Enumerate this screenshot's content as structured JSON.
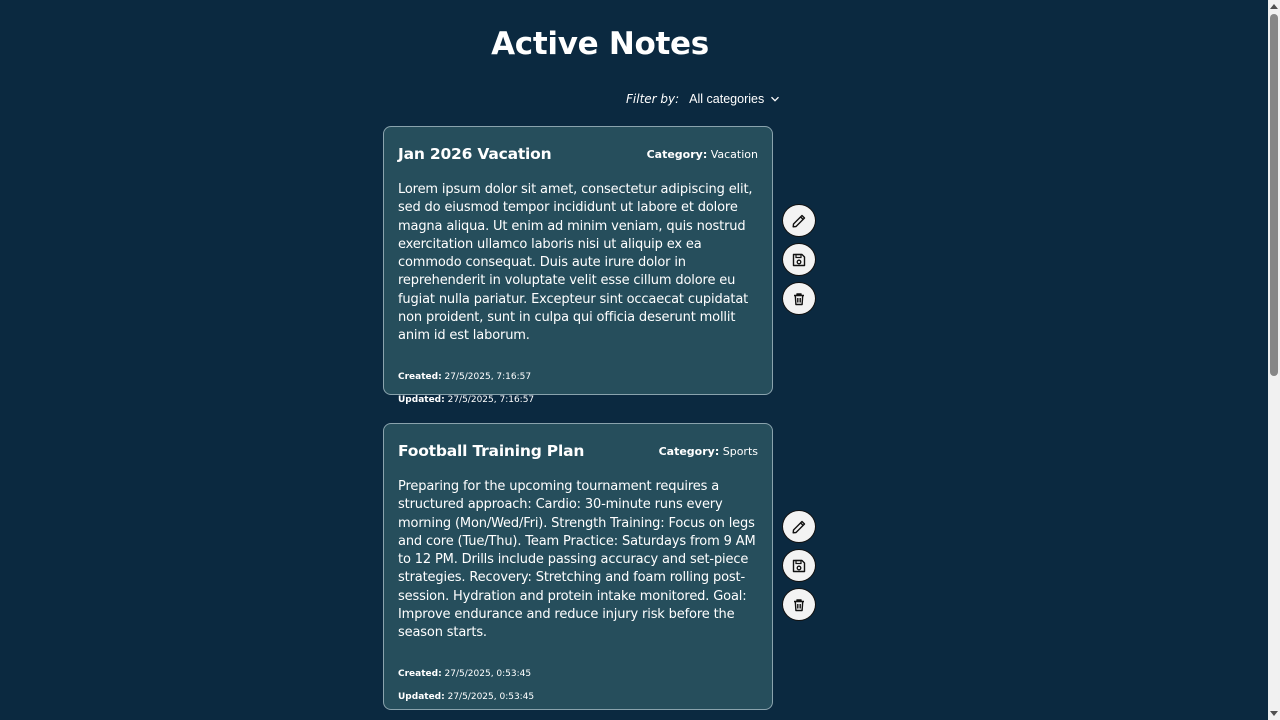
{
  "page": {
    "title": "Active Notes"
  },
  "filter": {
    "label": "Filter by:",
    "selected": "All categories"
  },
  "notes": [
    {
      "title": "Jan 2026 Vacation",
      "category_label": "Category:",
      "category": "Vacation",
      "body": "Lorem ipsum dolor sit amet, consectetur adipiscing elit, sed do eiusmod tempor incididunt ut labore et dolore magna aliqua. Ut enim ad minim veniam, quis nostrud exercitation ullamco laboris nisi ut aliquip ex ea commodo consequat. Duis aute irure dolor in reprehenderit in voluptate velit esse cillum dolore eu fugiat nulla pariatur. Excepteur sint occaecat cupidatat non proident, sunt in culpa qui officia deserunt mollit anim id est laborum.",
      "created_label": "Created:",
      "created": "27/5/2025, 7:16:57",
      "updated_label": "Updated:",
      "updated": "27/5/2025, 7:16:57"
    },
    {
      "title": "Football Training Plan",
      "category_label": "Category:",
      "category": "Sports",
      "body": "Preparing for the upcoming tournament requires a structured approach: Cardio: 30-minute runs every morning (Mon/Wed/Fri). Strength Training: Focus on legs and core (Tue/Thu). Team Practice: Saturdays from 9 AM to 12 PM. Drills include passing accuracy and set-piece strategies. Recovery: Stretching and foam rolling post-session. Hydration and protein intake monitored. Goal: Improve endurance and reduce injury risk before the season starts.",
      "created_label": "Created:",
      "created": "27/5/2025, 0:53:45",
      "updated_label": "Updated:",
      "updated": "27/5/2025, 0:53:45"
    }
  ],
  "icons": {
    "edit": "pencil-icon",
    "save": "floppy-disk-icon",
    "delete": "trash-icon",
    "dropdown": "chevron-down-icon"
  },
  "colors": {
    "background": "#0b2940",
    "card": "#264e5c",
    "text": "#ffffff"
  }
}
